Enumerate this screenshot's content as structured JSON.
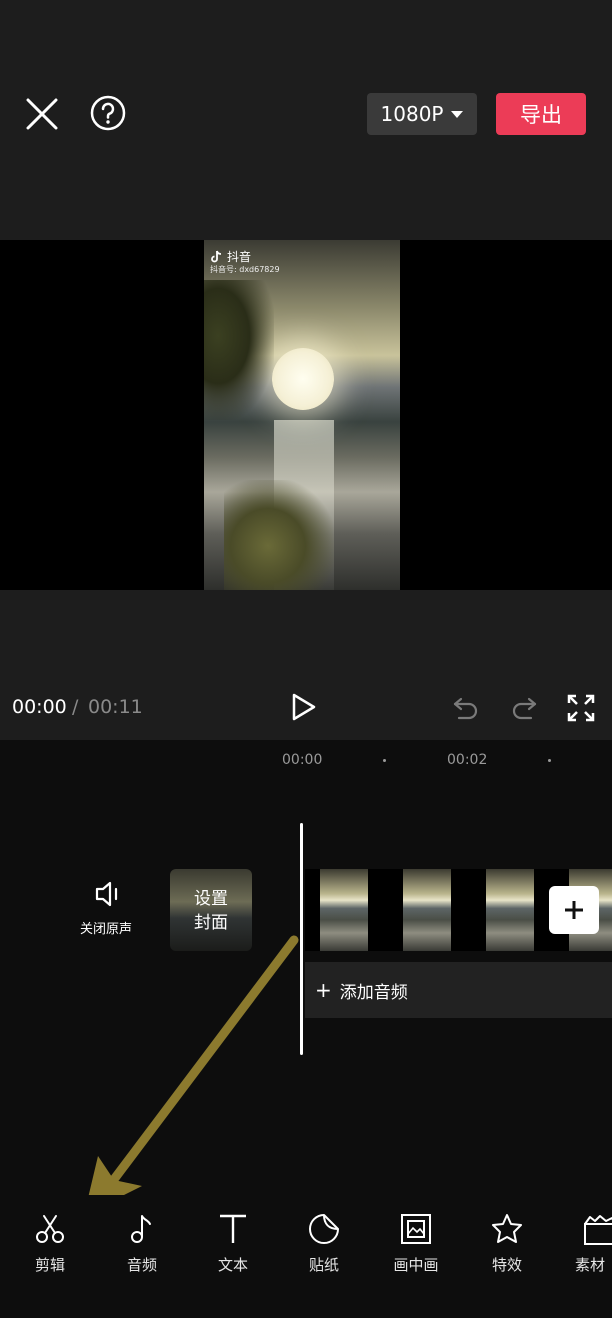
{
  "header": {
    "resolution_label": "1080P",
    "export_label": "导出",
    "export_color": "#ec3c57"
  },
  "preview": {
    "watermark_app": "抖音",
    "watermark_id": "抖音号: dxd67829"
  },
  "playback": {
    "current_time": "00:00",
    "separator": "/",
    "total_time": "00:11"
  },
  "timeline": {
    "ruler_marks": [
      "00:00",
      "00:02"
    ],
    "mute_label": "关闭原声",
    "cover_label_line1": "设置",
    "cover_label_line2": "封面",
    "add_audio_plus": "+",
    "add_audio_label": "添加音频"
  },
  "toolbar": {
    "items": [
      {
        "label": "剪辑",
        "icon": "scissors-icon"
      },
      {
        "label": "音频",
        "icon": "music-note-icon"
      },
      {
        "label": "文本",
        "icon": "text-icon"
      },
      {
        "label": "贴纸",
        "icon": "sticker-icon"
      },
      {
        "label": "画中画",
        "icon": "picture-in-picture-icon"
      },
      {
        "label": "特效",
        "icon": "effects-star-icon"
      },
      {
        "label": "素材",
        "icon": "material-icon"
      }
    ]
  }
}
